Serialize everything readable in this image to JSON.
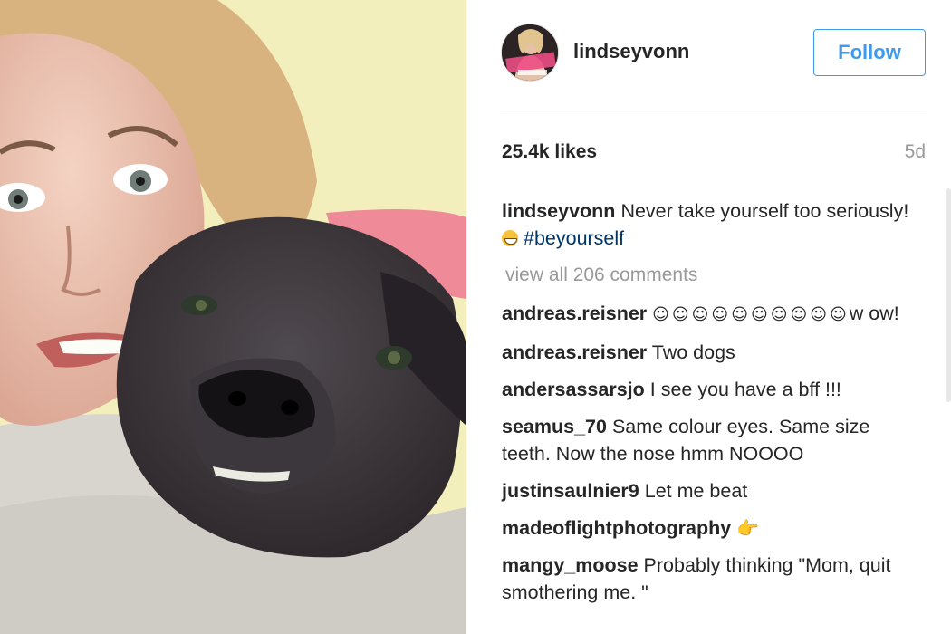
{
  "post": {
    "photo_alt": "Selfie of a woman cuddling a dark brindle dog on a couch",
    "username": "lindseyvonn",
    "follow_label": "Follow",
    "likes": "25.4k likes",
    "age": "5d",
    "caption": {
      "user": "lindseyvonn",
      "text": "Never take yourself too seriously!",
      "hashtag": "#beyourself"
    },
    "view_all_comments": "view all 206 comments",
    "comments": [
      {
        "user": "andreas.reisner",
        "text": "☺☺☺☺☺☺☺☺☺☺",
        "extra": "w ow!"
      },
      {
        "user": "andreas.reisner",
        "text": "Two dogs"
      },
      {
        "user": "andersassarsjo",
        "text": "I see you have a bff !!!"
      },
      {
        "user": "seamus_70",
        "text": "Same colour eyes. Same size teeth. Now the nose hmm NOOOO"
      },
      {
        "user": "justinsaulnier9",
        "text": "Let me beat"
      },
      {
        "user": "madeoflightphotography",
        "text": "👉"
      },
      {
        "user": "mangy_moose",
        "text": "Probably thinking \"Mom, quit smothering me. \""
      }
    ]
  },
  "colors": {
    "follow_blue": "#3f99ed",
    "hashtag_blue": "#003569",
    "meta_gray": "#999999"
  },
  "icons": {
    "avatar": "profile-avatar-strong-is-beautiful",
    "grin": "grinning-face-emoji",
    "hand": "pointing-hand-emoji"
  }
}
